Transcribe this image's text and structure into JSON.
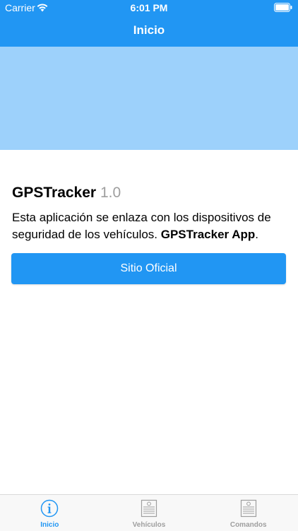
{
  "status_bar": {
    "carrier": "Carrier",
    "time": "6:01 PM"
  },
  "nav": {
    "title": "Inicio"
  },
  "app": {
    "name": "GPSTracker",
    "version": "1.0",
    "description_part1": "Esta aplicación se enlaza con los dispositivos de seguridad de los vehículos. ",
    "description_bold": "GPSTracker App",
    "description_end": "."
  },
  "button": {
    "label": "Sitio Oficial"
  },
  "tabs": [
    {
      "label": "Inicio",
      "icon": "info-icon",
      "active": true
    },
    {
      "label": "Vehículos",
      "icon": "document-icon",
      "active": false
    },
    {
      "label": "Comandos",
      "icon": "document-icon",
      "active": false
    }
  ],
  "colors": {
    "primary": "#2196f3",
    "banner": "#9dd1fb",
    "inactive_tab": "#9e9e9e"
  }
}
